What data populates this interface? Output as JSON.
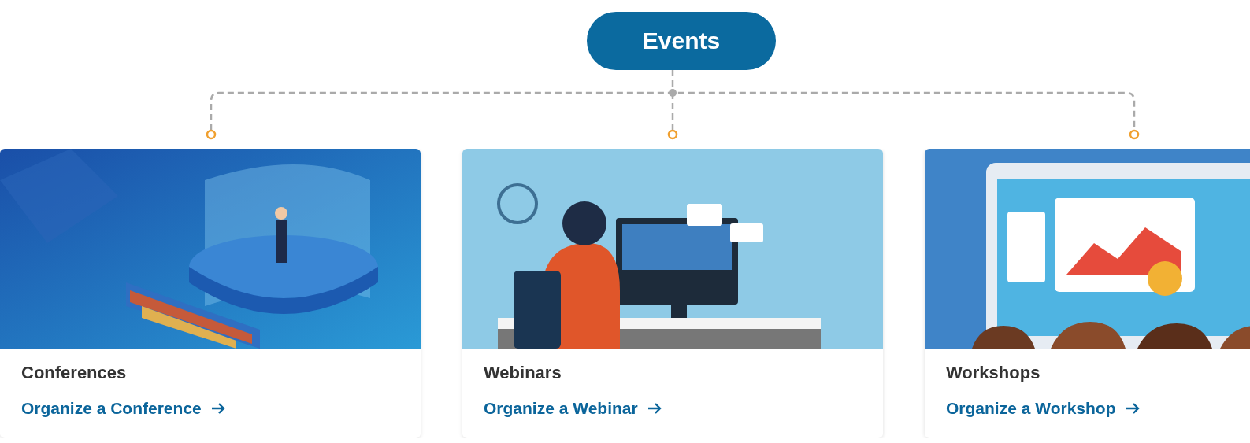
{
  "header": {
    "title": "Events"
  },
  "cards": [
    {
      "title": "Conferences",
      "link": "Organize a Conference"
    },
    {
      "title": "Webinars",
      "link": "Organize a Webinar"
    },
    {
      "title": "Workshops",
      "link": "Organize a Workshop"
    }
  ]
}
